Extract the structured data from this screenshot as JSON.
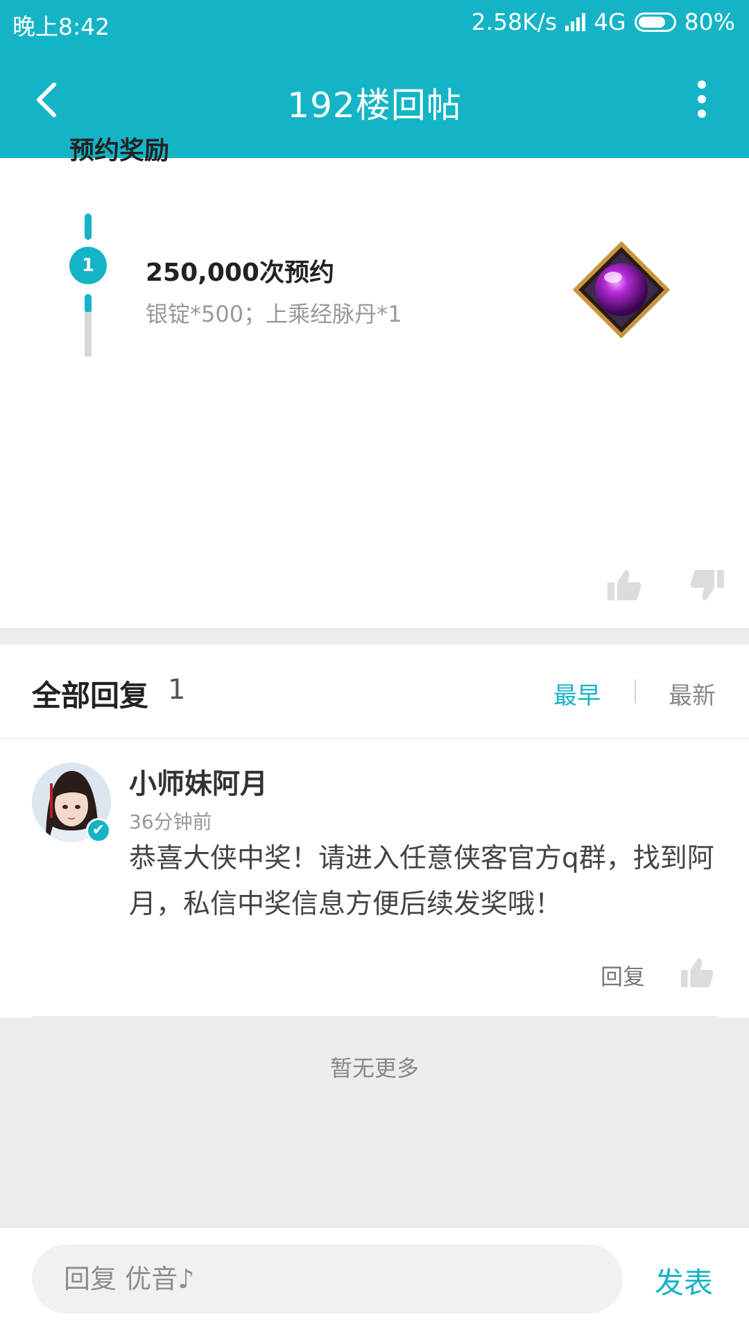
{
  "status_bar": {
    "time": "晚上8:42",
    "speed": "2.58K/s",
    "network": "4G",
    "battery": "80%"
  },
  "header": {
    "title": "192楼回帖",
    "back_icon": "chevron-left-icon",
    "more_icon": "more-vertical-icon"
  },
  "post": {
    "section_title": "预约奖励",
    "rewards": [
      {
        "step": "1",
        "title": "250,000次预约",
        "desc": "银锭*500；上乘经脉丹*1",
        "icon": "purple-gem-icon"
      }
    ],
    "like_icon": "thumbs-up-icon",
    "dislike_icon": "thumbs-down-icon"
  },
  "replies": {
    "label": "全部回复",
    "count": "1",
    "sort_earliest": "最早",
    "sort_newest": "最新",
    "items": [
      {
        "name": "小师妹阿月",
        "time": "36分钟前",
        "text": "恭喜大侠中奖！请进入任意侠客官方q群，找到阿月，私信中奖信息方便后续发奖哦！",
        "reply_label": "回复"
      }
    ],
    "no_more": "暂无更多"
  },
  "bottom": {
    "placeholder": "回复 优音♪",
    "send_label": "发表"
  },
  "colors": {
    "accent": "#14b4c6",
    "background_gray": "#ececec"
  }
}
